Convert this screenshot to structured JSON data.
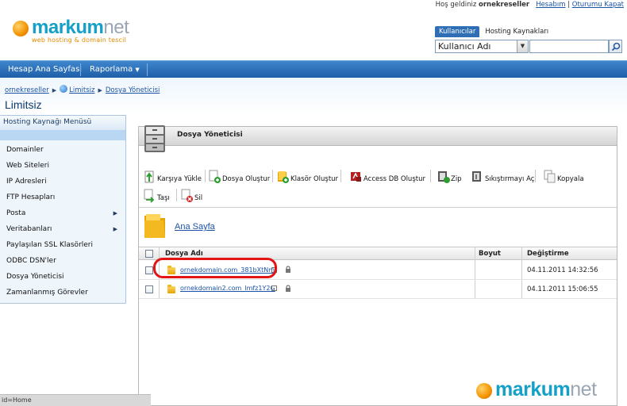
{
  "brand": {
    "name_main": "markum",
    "name_suffix": "net",
    "tagline": "web hosting & domain tescil"
  },
  "header": {
    "greeting": "Hoş geldiniz",
    "username": "ornekreseller",
    "account_link": "Hesabım",
    "separator": "|",
    "logout_link": "Oturumu Kapat",
    "user_tabs": [
      "Kullanıcılar",
      "Hosting Kaynakları"
    ],
    "user_select_value": "Kullanıcı Adı"
  },
  "nav": {
    "items": [
      "Hesap Ana Sayfası",
      "Raporlama"
    ]
  },
  "breadcrumb": {
    "items": [
      "ornekreseller",
      "Limitsiz",
      "Dosya Yöneticisi"
    ]
  },
  "page_title": "Limitsiz",
  "sidebar": {
    "title": "Hosting Kaynağı Menüsü",
    "items": [
      {
        "label": "Domainler",
        "has_submenu": false
      },
      {
        "label": "Web Siteleri",
        "has_submenu": false
      },
      {
        "label": "IP Adresleri",
        "has_submenu": false
      },
      {
        "label": "FTP Hesapları",
        "has_submenu": false
      },
      {
        "label": "Posta",
        "has_submenu": true
      },
      {
        "label": "Veritabanları",
        "has_submenu": true
      },
      {
        "label": "Paylaşılan SSL Klasörleri",
        "has_submenu": false
      },
      {
        "label": "ODBC DSN'ler",
        "has_submenu": false
      },
      {
        "label": "Dosya Yöneticisi",
        "has_submenu": false
      },
      {
        "label": "Zamanlanmış Görevler",
        "has_submenu": false
      }
    ]
  },
  "panel": {
    "title": "Dosya Yöneticisi",
    "toolbar": {
      "upload": "Karşıya Yükle",
      "create_file": "Dosya Oluştur",
      "create_folder": "Klasör Oluştur",
      "access_db": "Access DB Oluştur",
      "zip": "Zip",
      "unzip": "Sıkıştırmayı Aç",
      "copy": "Kopyala",
      "move": "Taşı",
      "delete": "Sil"
    },
    "home_link": "Ana Sayfa",
    "table": {
      "columns": [
        "Dosya Adı",
        "Boyut",
        "Değiştirme"
      ],
      "rows": [
        {
          "name": "ornekdomain.com_381bXtNm",
          "size": "",
          "modified": "04.11.2011 14:32:56"
        },
        {
          "name": "ornekdomain2.com_lmfz1Y2G",
          "size": "",
          "modified": "04.11.2011 15:06:55"
        }
      ]
    }
  },
  "status_bar": "id=Home",
  "colors": {
    "nav_blue": "#2a6db5",
    "link_blue": "#1a52a8",
    "brand_teal": "#15a0c8",
    "brand_orange": "#f39200",
    "highlight_red": "#e21414"
  }
}
